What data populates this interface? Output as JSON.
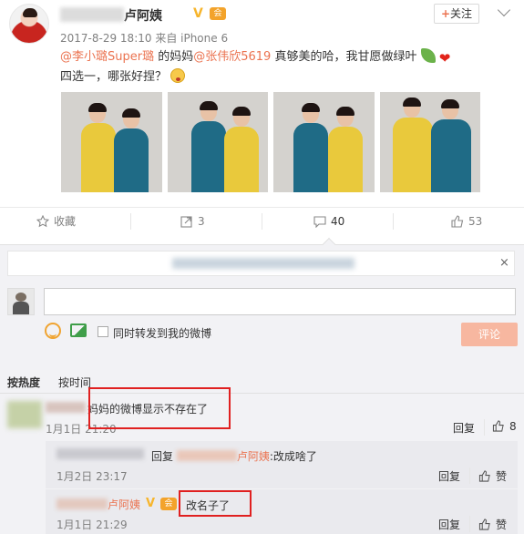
{
  "post": {
    "author_visible": "卢阿姨",
    "verified_mark": "V",
    "member_mark": "会",
    "follow_label": "关注",
    "follow_plus": "+",
    "meta": "2017-8-29 18:10 来自 iPhone 6",
    "text_parts": {
      "mention1": "@李小璐Super璐",
      "t1": " 的妈妈",
      "mention2": "@张伟欣5619",
      "t2": " 真够美的哈，我甘愿做绿叶",
      "line2": "四选一，哪张好捏？"
    }
  },
  "actions": {
    "favorite": "收藏",
    "forward_count": "3",
    "comment_count": "40",
    "like_count": "53"
  },
  "notice_close": "×",
  "composer": {
    "forward_label": "同时转发到我的微博",
    "submit_label": "评论"
  },
  "sort": {
    "hot": "按热度",
    "time": "按时间"
  },
  "comments": [
    {
      "text": "妈妈的微博显示不存在了",
      "time": "1月1日 21:20",
      "reply_label": "回复",
      "like_count": "8"
    }
  ],
  "replies": [
    {
      "prefix": "回复",
      "target_visible": "卢阿姨",
      "text": ":改成啥了",
      "time": "1月2日 23:17",
      "reply_label": "回复",
      "like_label": "赞"
    },
    {
      "name_visible": "卢阿姨",
      "verified_mark": "V",
      "member_mark": "会",
      "text": "改名子了",
      "time": "1月1日 21:29",
      "reply_label": "回复",
      "like_label": "赞"
    }
  ],
  "colors": {
    "link": "#eb7350",
    "highlight_box": "#e02020",
    "submit_bg": "#f7b7a0",
    "panel_bg": "#f2f2f5"
  },
  "icons": [
    "star-icon",
    "forward-icon",
    "comment-icon",
    "thumbs-up-icon",
    "emoji-icon",
    "image-icon",
    "close-icon",
    "chevron-down-icon"
  ]
}
